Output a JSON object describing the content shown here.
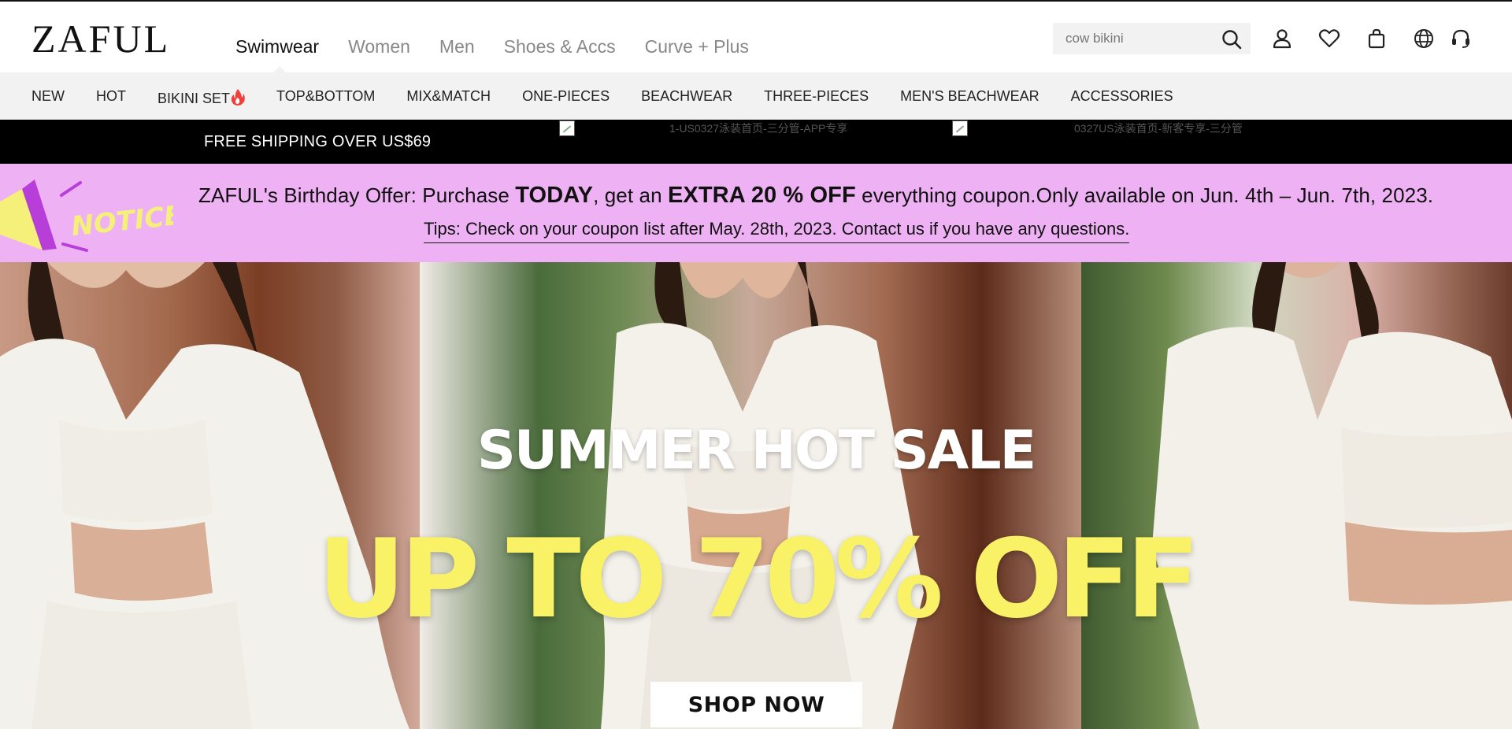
{
  "header": {
    "logo": "ZAFUL",
    "nav": [
      {
        "label": "Swimwear",
        "active": true
      },
      {
        "label": "Women"
      },
      {
        "label": "Men"
      },
      {
        "label": "Shoes & Accs"
      },
      {
        "label": "Curve + Plus"
      }
    ],
    "search": {
      "value": "",
      "placeholder": "cow bikini"
    },
    "icons": [
      "search-icon",
      "account-icon",
      "wishlist-icon",
      "bag-icon",
      "globe-icon",
      "support-icon"
    ]
  },
  "categories": [
    {
      "label": "NEW"
    },
    {
      "label": "HOT"
    },
    {
      "label": "BIKINI SET",
      "badge": "fire-icon"
    },
    {
      "label": "TOP&BOTTOM"
    },
    {
      "label": "MIX&MATCH"
    },
    {
      "label": "ONE-PIECES"
    },
    {
      "label": "BEACHWEAR"
    },
    {
      "label": "THREE-PIECES"
    },
    {
      "label": "MEN'S BEACHWEAR"
    },
    {
      "label": "ACCESSORIES"
    }
  ],
  "promo_strip": {
    "free_shipping": "FREE SHIPPING OVER US$69",
    "img_alt_1": "1-US0327泳装首页-三分管-APP专享",
    "img_alt_2": "0327US泳装首页-新客专享-三分管"
  },
  "notice": {
    "badge": "NOTICE",
    "line1_a": "ZAFUL's Birthday Offer: Purchase ",
    "line1_b": "TODAY",
    "line1_c": ", get an ",
    "line1_d": "EXTRA 20 % OFF",
    "line1_e": " everything coupon.Only available on Jun. 4th – Jun. 7th, 2023.",
    "line2": "Tips: Check on your coupon list after May. 28th, 2023. Contact us if you have any questions."
  },
  "hero": {
    "title": "SUMMER HOT SALE",
    "subtitle": "UP TO 70% OFF",
    "cta": "SHOP NOW"
  },
  "colors": {
    "notice_bg": "#eeb1f4",
    "hero_accent": "#f9f266",
    "promo_strip_bg": "#000000",
    "category_bar_bg": "#f2f2f2"
  }
}
